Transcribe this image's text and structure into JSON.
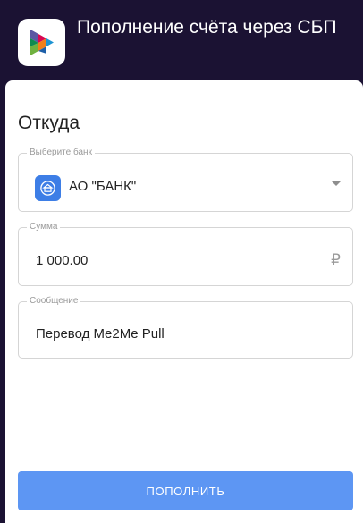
{
  "header": {
    "title": "Пополнение счёта через СБП",
    "logo_icon": "sbp-logo-icon"
  },
  "form": {
    "section_title": "Откуда",
    "bank": {
      "label": "Выберите банк",
      "value": "АО \"БАНК\"",
      "icon": "bank-building-icon"
    },
    "amount": {
      "label": "Сумма",
      "value": "1 000.00",
      "currency": "₽"
    },
    "message": {
      "label": "Сообщение",
      "value": "Перевод Me2Me Pull"
    },
    "submit_label": "ПОПОЛНИТЬ"
  },
  "colors": {
    "header_bg": "#1b1233",
    "button_bg": "#5d96f3",
    "bank_logo_bg": "#3d7ee6"
  }
}
